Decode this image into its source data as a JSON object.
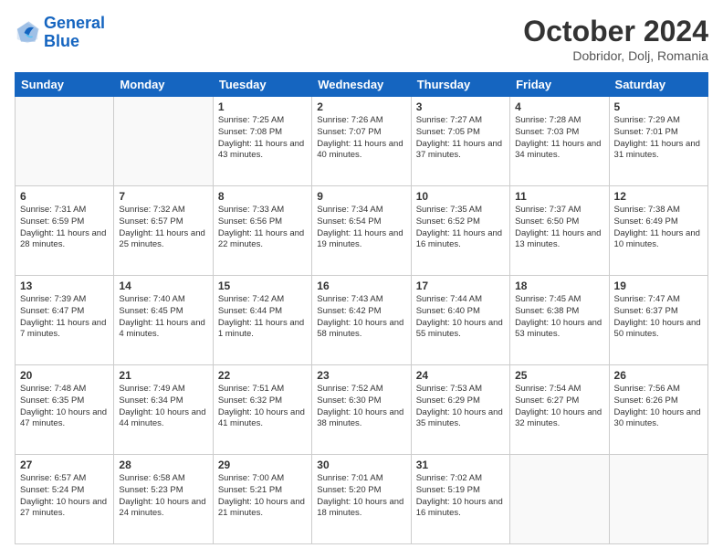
{
  "header": {
    "logo_general": "General",
    "logo_blue": "Blue",
    "month_title": "October 2024",
    "location": "Dobridor, Dolj, Romania"
  },
  "days_of_week": [
    "Sunday",
    "Monday",
    "Tuesday",
    "Wednesday",
    "Thursday",
    "Friday",
    "Saturday"
  ],
  "weeks": [
    [
      {
        "day": "",
        "content": ""
      },
      {
        "day": "",
        "content": ""
      },
      {
        "day": "1",
        "content": "Sunrise: 7:25 AM\nSunset: 7:08 PM\nDaylight: 11 hours and 43 minutes."
      },
      {
        "day": "2",
        "content": "Sunrise: 7:26 AM\nSunset: 7:07 PM\nDaylight: 11 hours and 40 minutes."
      },
      {
        "day": "3",
        "content": "Sunrise: 7:27 AM\nSunset: 7:05 PM\nDaylight: 11 hours and 37 minutes."
      },
      {
        "day": "4",
        "content": "Sunrise: 7:28 AM\nSunset: 7:03 PM\nDaylight: 11 hours and 34 minutes."
      },
      {
        "day": "5",
        "content": "Sunrise: 7:29 AM\nSunset: 7:01 PM\nDaylight: 11 hours and 31 minutes."
      }
    ],
    [
      {
        "day": "6",
        "content": "Sunrise: 7:31 AM\nSunset: 6:59 PM\nDaylight: 11 hours and 28 minutes."
      },
      {
        "day": "7",
        "content": "Sunrise: 7:32 AM\nSunset: 6:57 PM\nDaylight: 11 hours and 25 minutes."
      },
      {
        "day": "8",
        "content": "Sunrise: 7:33 AM\nSunset: 6:56 PM\nDaylight: 11 hours and 22 minutes."
      },
      {
        "day": "9",
        "content": "Sunrise: 7:34 AM\nSunset: 6:54 PM\nDaylight: 11 hours and 19 minutes."
      },
      {
        "day": "10",
        "content": "Sunrise: 7:35 AM\nSunset: 6:52 PM\nDaylight: 11 hours and 16 minutes."
      },
      {
        "day": "11",
        "content": "Sunrise: 7:37 AM\nSunset: 6:50 PM\nDaylight: 11 hours and 13 minutes."
      },
      {
        "day": "12",
        "content": "Sunrise: 7:38 AM\nSunset: 6:49 PM\nDaylight: 11 hours and 10 minutes."
      }
    ],
    [
      {
        "day": "13",
        "content": "Sunrise: 7:39 AM\nSunset: 6:47 PM\nDaylight: 11 hours and 7 minutes."
      },
      {
        "day": "14",
        "content": "Sunrise: 7:40 AM\nSunset: 6:45 PM\nDaylight: 11 hours and 4 minutes."
      },
      {
        "day": "15",
        "content": "Sunrise: 7:42 AM\nSunset: 6:44 PM\nDaylight: 11 hours and 1 minute."
      },
      {
        "day": "16",
        "content": "Sunrise: 7:43 AM\nSunset: 6:42 PM\nDaylight: 10 hours and 58 minutes."
      },
      {
        "day": "17",
        "content": "Sunrise: 7:44 AM\nSunset: 6:40 PM\nDaylight: 10 hours and 55 minutes."
      },
      {
        "day": "18",
        "content": "Sunrise: 7:45 AM\nSunset: 6:38 PM\nDaylight: 10 hours and 53 minutes."
      },
      {
        "day": "19",
        "content": "Sunrise: 7:47 AM\nSunset: 6:37 PM\nDaylight: 10 hours and 50 minutes."
      }
    ],
    [
      {
        "day": "20",
        "content": "Sunrise: 7:48 AM\nSunset: 6:35 PM\nDaylight: 10 hours and 47 minutes."
      },
      {
        "day": "21",
        "content": "Sunrise: 7:49 AM\nSunset: 6:34 PM\nDaylight: 10 hours and 44 minutes."
      },
      {
        "day": "22",
        "content": "Sunrise: 7:51 AM\nSunset: 6:32 PM\nDaylight: 10 hours and 41 minutes."
      },
      {
        "day": "23",
        "content": "Sunrise: 7:52 AM\nSunset: 6:30 PM\nDaylight: 10 hours and 38 minutes."
      },
      {
        "day": "24",
        "content": "Sunrise: 7:53 AM\nSunset: 6:29 PM\nDaylight: 10 hours and 35 minutes."
      },
      {
        "day": "25",
        "content": "Sunrise: 7:54 AM\nSunset: 6:27 PM\nDaylight: 10 hours and 32 minutes."
      },
      {
        "day": "26",
        "content": "Sunrise: 7:56 AM\nSunset: 6:26 PM\nDaylight: 10 hours and 30 minutes."
      }
    ],
    [
      {
        "day": "27",
        "content": "Sunrise: 6:57 AM\nSunset: 5:24 PM\nDaylight: 10 hours and 27 minutes."
      },
      {
        "day": "28",
        "content": "Sunrise: 6:58 AM\nSunset: 5:23 PM\nDaylight: 10 hours and 24 minutes."
      },
      {
        "day": "29",
        "content": "Sunrise: 7:00 AM\nSunset: 5:21 PM\nDaylight: 10 hours and 21 minutes."
      },
      {
        "day": "30",
        "content": "Sunrise: 7:01 AM\nSunset: 5:20 PM\nDaylight: 10 hours and 18 minutes."
      },
      {
        "day": "31",
        "content": "Sunrise: 7:02 AM\nSunset: 5:19 PM\nDaylight: 10 hours and 16 minutes."
      },
      {
        "day": "",
        "content": ""
      },
      {
        "day": "",
        "content": ""
      }
    ]
  ]
}
